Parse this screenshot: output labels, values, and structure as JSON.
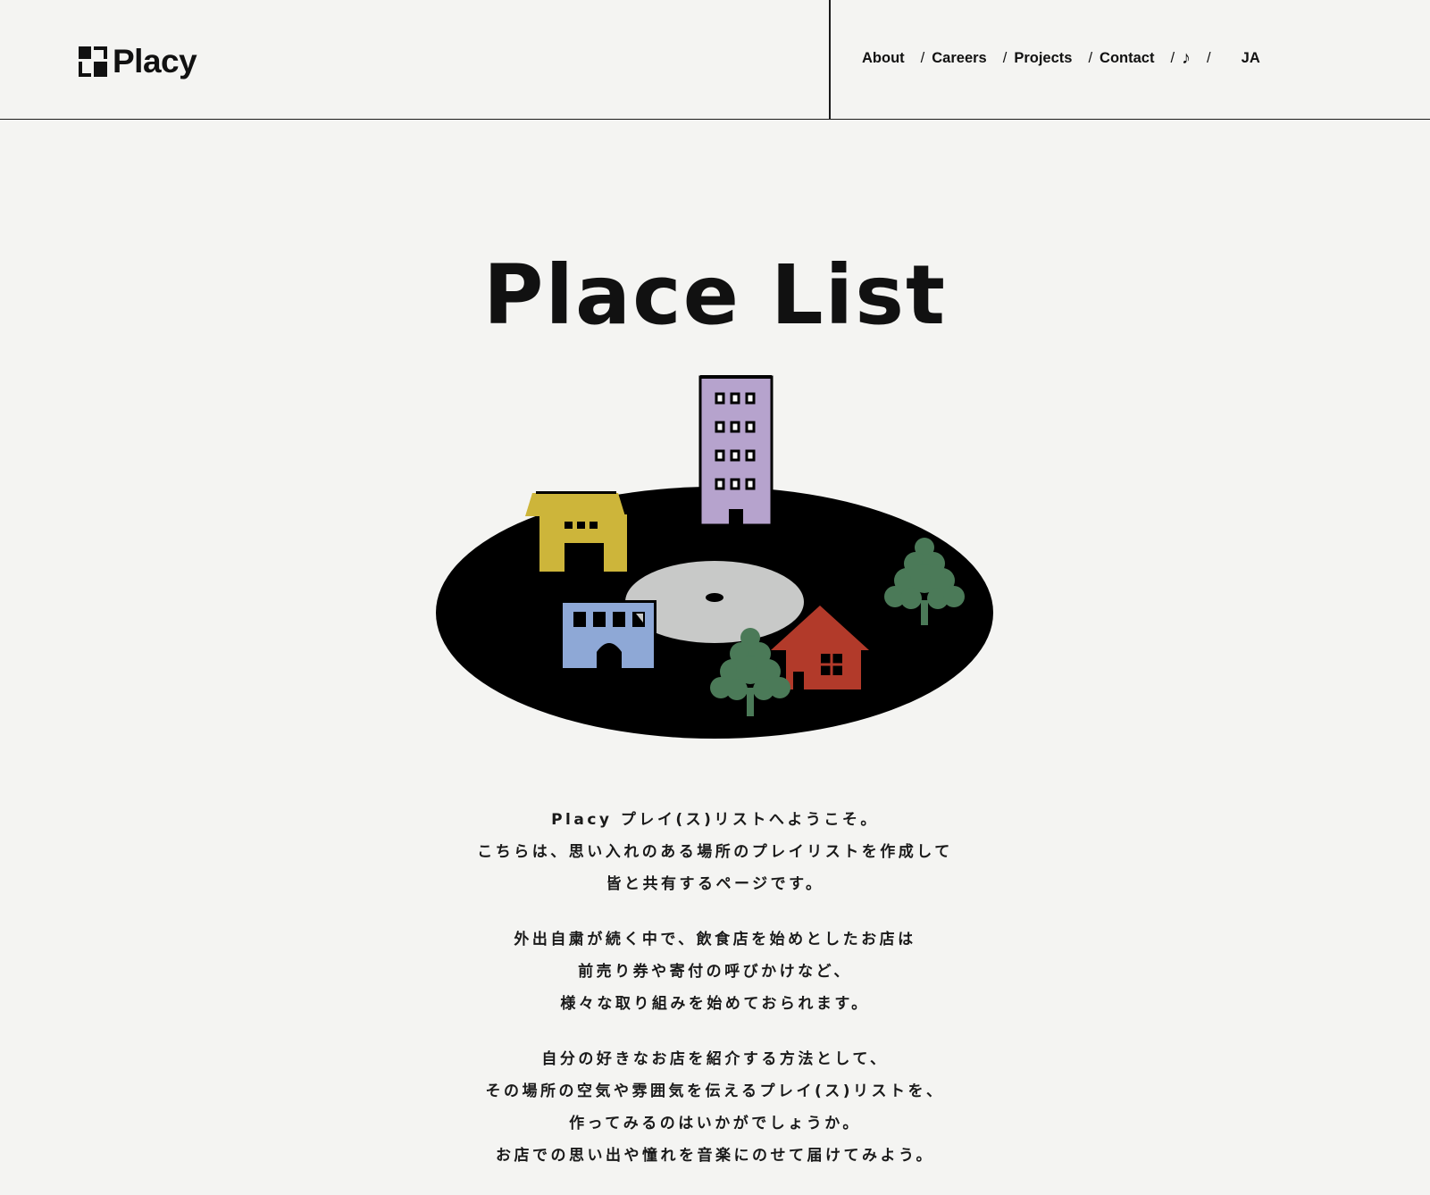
{
  "header": {
    "logo_text": "Placy",
    "nav": {
      "about": "About",
      "careers": "Careers",
      "projects": "Projects",
      "contact": "Contact",
      "music": "♪",
      "lang": "JA",
      "separator": "/"
    }
  },
  "hero": {
    "title": "Place List"
  },
  "intro": {
    "paragraphs": [
      [
        "Placy プレイ(ス)リストへようこそ。",
        "こちらは、思い入れのある場所のプレイリストを作成して",
        "皆と共有するページです。"
      ],
      [
        "外出自粛が続く中で、飲食店を始めとしたお店は",
        "前売り券や寄付の呼びかけなど、",
        "様々な取り組みを始めておられます。"
      ],
      [
        "自分の好きなお店を紹介する方法として、",
        "その場所の空気や雰囲気を伝えるプレイ(ス)リストを、",
        "作ってみるのはいかがでしょうか。",
        "お店での思い出や憧れを音楽にのせて届けてみよう。"
      ]
    ]
  },
  "colors": {
    "background": "#f4f4f2",
    "record": "#000000",
    "record_label": "#c8c9c8",
    "yellow_house": "#cdb53a",
    "purple_building": "#b6a3cd",
    "blue_building": "#8ea8d6",
    "red_house": "#b23a2a",
    "tree": "#4b7a58"
  }
}
